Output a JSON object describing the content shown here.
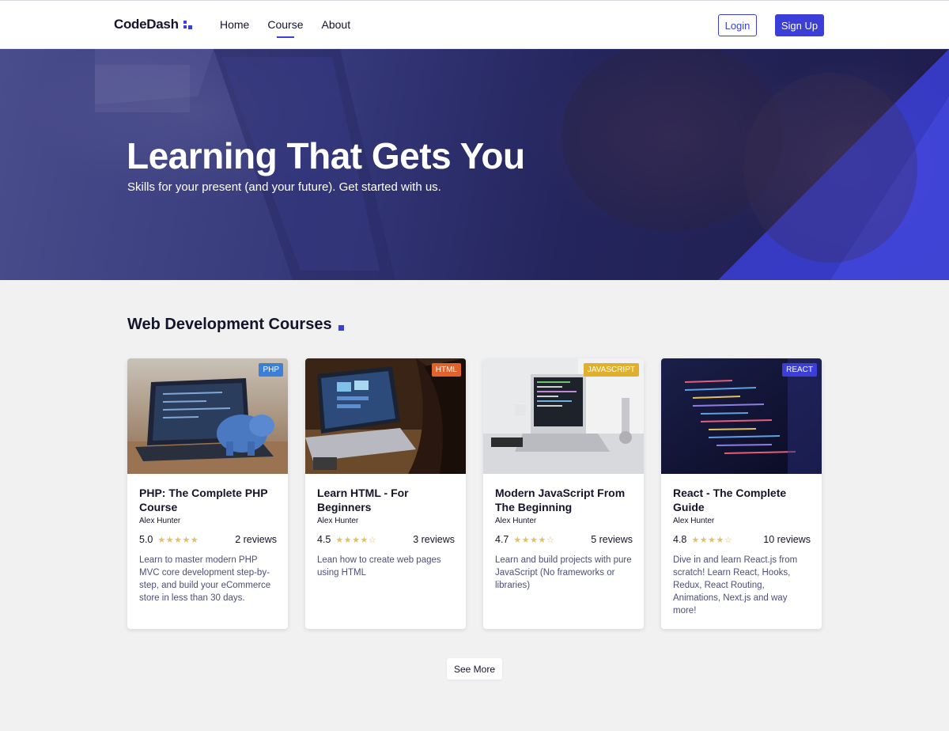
{
  "brand": {
    "name": "CodeDash",
    "accent": "#3b3fd8",
    "icon": "logo-squares-icon"
  },
  "nav": {
    "links": [
      {
        "label": "Home",
        "active": false
      },
      {
        "label": "Course",
        "active": true
      },
      {
        "label": "About",
        "active": false
      }
    ],
    "login_label": "Login",
    "signup_label": "Sign Up"
  },
  "hero": {
    "title": "Learning That Gets You",
    "subtitle": "Skills for your present (and your future). Get started with us."
  },
  "courses_section": {
    "title": "Web Development Courses",
    "cards": [
      {
        "badge": "PHP",
        "badge_color": "#3b7fd8",
        "title": "PHP: The Complete PHP Course",
        "author": "Alex Hunter",
        "rating": "5.0",
        "stars": "★★★★★",
        "reviews": "2 reviews",
        "description": "Learn to master modern PHP MVC core development step-by-step, and build your eCommerce store in less than 30 days."
      },
      {
        "badge": "HTML",
        "badge_color": "#e0622d",
        "title": "Learn HTML - For Beginners",
        "author": "Alex Hunter",
        "rating": "4.5",
        "stars": "★★★★☆",
        "reviews": "3 reviews",
        "description": "Lean how to create web pages using HTML"
      },
      {
        "badge": "JAVASCRIPT",
        "badge_color": "#e0b02d",
        "title": "Modern JavaScript From The Beginning",
        "author": "Alex Hunter",
        "rating": "4.7",
        "stars": "★★★★☆",
        "reviews": "5 reviews",
        "description": "Learn and build projects with pure JavaScript (No frameworks or libraries)"
      },
      {
        "badge": "REACT",
        "badge_color": "#3b3fd8",
        "title": "React - The Complete Guide",
        "author": "Alex Hunter",
        "rating": "4.8",
        "stars": "★★★★☆",
        "reviews": "10 reviews",
        "description": "Dive in and learn React.js from scratch! Learn React, Hooks, Redux, React Routing, Animations, Next.js and way more!"
      }
    ],
    "see_more_label": "See More"
  }
}
